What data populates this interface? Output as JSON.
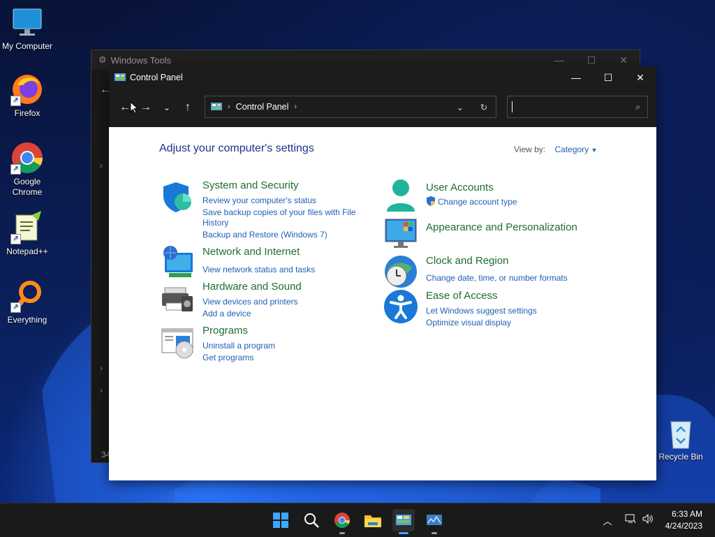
{
  "desktop": {
    "icons": [
      {
        "label": "My Computer"
      },
      {
        "label": "Firefox"
      },
      {
        "label": "Google Chrome"
      },
      {
        "label": "Notepad++"
      },
      {
        "label": "Everything"
      },
      {
        "label": "Recycle Bin"
      }
    ]
  },
  "windows_tools": {
    "title": "Windows Tools",
    "status_partial": "34"
  },
  "control_panel": {
    "title": "Control Panel",
    "address": "Control Panel",
    "search_placeholder": "",
    "heading": "Adjust your computer's settings",
    "view_by_label": "View by:",
    "view_by_value": "Category",
    "categories": [
      {
        "title": "System and Security",
        "links": [
          "Review your computer's status",
          "Save backup copies of your files with File",
          "History",
          "Backup and Restore (Windows 7)"
        ]
      },
      {
        "title": "Network and Internet",
        "links": [
          "View network status and tasks"
        ]
      },
      {
        "title": "Hardware and Sound",
        "links": [
          "View devices and printers",
          "Add a device"
        ]
      },
      {
        "title": "Programs",
        "links": [
          "Uninstall a program",
          "Get programs"
        ]
      },
      {
        "title": "User Accounts",
        "links": [
          "Change account type"
        ]
      },
      {
        "title": "Appearance and Personalization",
        "links": []
      },
      {
        "title": "Clock and Region",
        "links": [
          "Change date, time, or number formats"
        ]
      },
      {
        "title": "Ease of Access",
        "links": [
          "Let Windows suggest settings",
          "Optimize visual display"
        ]
      }
    ]
  },
  "taskbar": {
    "time": "6:33 AM",
    "date": "4/24/2023"
  },
  "colors": {
    "link": "#1e5fb4",
    "category_title": "#1e6e2e",
    "heading": "#1e3287",
    "dark_chrome": "#1c1c1c"
  }
}
